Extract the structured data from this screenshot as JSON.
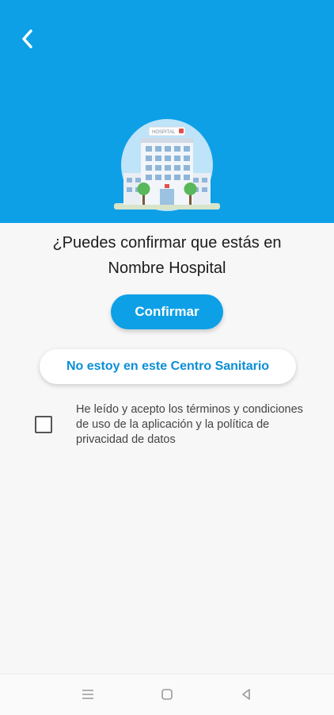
{
  "header": {
    "background_color": "#0ea0e6",
    "back_icon": "chevron-left-icon",
    "illustration": {
      "icon": "hospital-building-illustration",
      "sign_text": "HOSPITAL"
    }
  },
  "main": {
    "question_line1": "¿Puedes confirmar que estás en",
    "question_line2": "Nombre Hospital",
    "confirm_label": "Confirmar",
    "not_here_label": "No estoy en este Centro Sanitario",
    "terms_text": "He leído y acepto los términos y condiciones de uso de la aplicación y la política de privacidad de datos",
    "terms_checked": false
  },
  "navbar": {
    "menu_icon": "menu-icon",
    "home_icon": "home-square-icon",
    "back_icon": "back-triangle-icon"
  }
}
